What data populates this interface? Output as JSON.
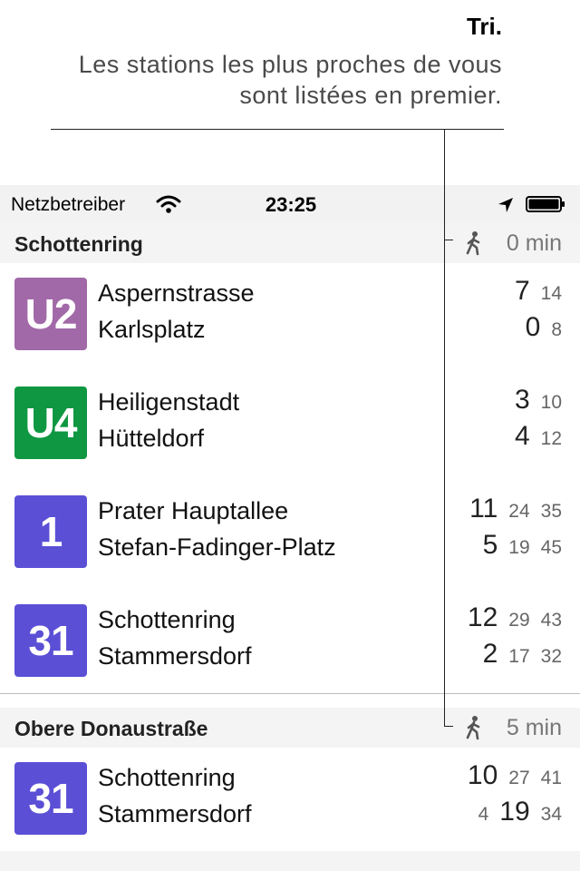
{
  "annotation": {
    "title": "Tri.",
    "description": "Les stations les plus proches de vous sont listées en premier."
  },
  "status_bar": {
    "carrier": "Netzbetreiber",
    "time": "23:25"
  },
  "sections": [
    {
      "station": "Schottenring",
      "walk_time": "0 min",
      "lines": [
        {
          "line": "U2",
          "color": "#a169a7",
          "directions": [
            {
              "destination": "Aspernstrasse",
              "times": [
                {
                  "v": "7",
                  "big": true
                },
                {
                  "v": "14",
                  "big": false
                }
              ]
            },
            {
              "destination": "Karlsplatz",
              "times": [
                {
                  "v": "0",
                  "big": true
                },
                {
                  "v": "8",
                  "big": false
                }
              ]
            }
          ]
        },
        {
          "line": "U4",
          "color": "#0f9742",
          "directions": [
            {
              "destination": "Heiligenstadt",
              "times": [
                {
                  "v": "3",
                  "big": true
                },
                {
                  "v": "10",
                  "big": false
                }
              ]
            },
            {
              "destination": "Hütteldorf",
              "times": [
                {
                  "v": "4",
                  "big": true
                },
                {
                  "v": "12",
                  "big": false
                }
              ]
            }
          ]
        },
        {
          "line": "1",
          "color": "#5b4fd6",
          "directions": [
            {
              "destination": "Prater Hauptallee",
              "times": [
                {
                  "v": "11",
                  "big": true
                },
                {
                  "v": "24",
                  "big": false
                },
                {
                  "v": "35",
                  "big": false
                }
              ]
            },
            {
              "destination": "Stefan-Fadinger-Platz",
              "times": [
                {
                  "v": "5",
                  "big": true
                },
                {
                  "v": "19",
                  "big": false
                },
                {
                  "v": "45",
                  "big": false
                }
              ]
            }
          ]
        },
        {
          "line": "31",
          "color": "#5b4fd6",
          "directions": [
            {
              "destination": "Schottenring",
              "times": [
                {
                  "v": "12",
                  "big": true
                },
                {
                  "v": "29",
                  "big": false
                },
                {
                  "v": "43",
                  "big": false
                }
              ]
            },
            {
              "destination": "Stammersdorf",
              "times": [
                {
                  "v": "2",
                  "big": true
                },
                {
                  "v": "17",
                  "big": false
                },
                {
                  "v": "32",
                  "big": false
                }
              ]
            }
          ]
        }
      ]
    },
    {
      "station": "Obere Donaustraße",
      "walk_time": "5 min",
      "lines": [
        {
          "line": "31",
          "color": "#5b4fd6",
          "directions": [
            {
              "destination": "Schottenring",
              "times": [
                {
                  "v": "10",
                  "big": true
                },
                {
                  "v": "27",
                  "big": false
                },
                {
                  "v": "41",
                  "big": false
                }
              ]
            },
            {
              "destination": "Stammersdorf",
              "times": [
                {
                  "v": "4",
                  "big": false
                },
                {
                  "v": "19",
                  "big": true
                },
                {
                  "v": "34",
                  "big": false
                }
              ]
            }
          ]
        }
      ]
    }
  ],
  "icons": {
    "wifi": "wifi-icon",
    "location": "location-arrow-icon",
    "battery": "battery-icon",
    "walk": "pedestrian-icon"
  }
}
